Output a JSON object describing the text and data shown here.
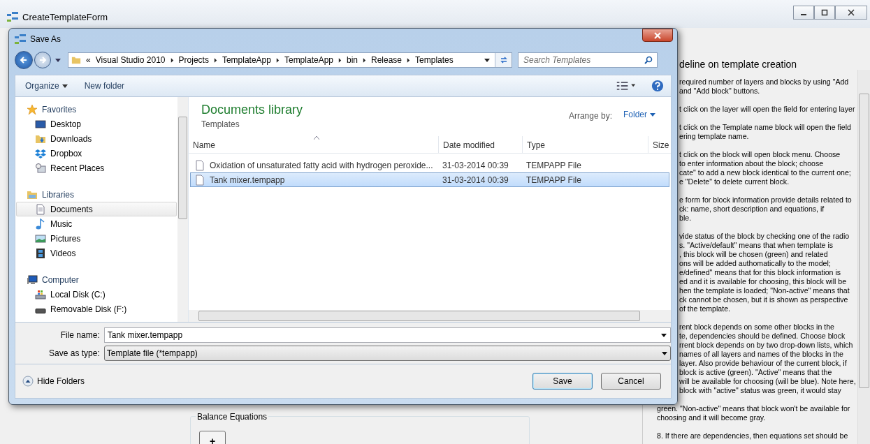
{
  "window": {
    "title": "CreateTemplateForm"
  },
  "guideline": {
    "heading": "deline on template creation",
    "upper_paragraphs": [
      [
        "required number of layers and blocks by using \"Add",
        "and \"Add block\" buttons."
      ],
      [
        "t click on the layer will open the field for entering layer"
      ],
      [
        "t click on the Template name block will open the field",
        "ering template name."
      ],
      [
        "t click on the block will open block menu. Choose",
        "to enter information about the block; choose",
        "cate\" to add a new block identical to the current one;",
        "e \"Delete\" to delete current block."
      ],
      [
        "e form for block information provide details related to",
        "ck: name, short description and equations, if",
        "ble."
      ],
      [
        "vide status of the block by checking one of the radio",
        "s. \"Active/default\" means that when template is",
        ", this block will be chosen (green) and related",
        "ons will be added authomatically to the model;",
        "e/defined\" means that for this block information is",
        "ed and it is available for choosing, this block will be",
        "hen the template is loaded; \"Non-active\" means that",
        "ck cannot be chosen, but it is shown as perspective",
        "of the template."
      ],
      [
        "rent block depends on some other blocks in the",
        "te, dependencies should be defined. Choose block",
        "rrent block depends on by two drop-down lists, which",
        "names of all layers and names of the blocks in the",
        "layer. Also provide behaviour of the current block, if",
        "block is active (green). \"Active\" means that the",
        "will be available for choosing (will be blue). Note here,",
        "block with \"active\" status was green, it would stay"
      ]
    ],
    "lower_paragraphs": [
      [
        "green. \"Non-active\" means that block won't be available for",
        "choosing and it will become gray."
      ],
      [
        "8. If there are dependencies, then equations set should be"
      ]
    ]
  },
  "balance_group": {
    "title": "Balance Equations",
    "button": "+"
  },
  "dialog": {
    "title": "Save As",
    "breadcrumb": {
      "prefix": "«",
      "parts": [
        "Visual Studio 2010",
        "Projects",
        "TemplateApp",
        "TemplateApp",
        "bin",
        "Release",
        "Templates"
      ]
    },
    "search": {
      "placeholder": "Search Templates"
    },
    "toolbar": {
      "organize": "Organize",
      "new_folder": "New folder"
    },
    "nav": [
      {
        "label": "Favorites",
        "kind": "star",
        "children": [
          {
            "label": "Desktop",
            "kind": "desktop",
            "selected": false
          },
          {
            "label": "Downloads",
            "kind": "downloads",
            "selected": false
          },
          {
            "label": "Dropbox",
            "kind": "dropbox",
            "selected": false
          },
          {
            "label": "Recent Places",
            "kind": "recent",
            "selected": false
          }
        ]
      },
      {
        "label": "Libraries",
        "kind": "library",
        "children": [
          {
            "label": "Documents",
            "kind": "documents",
            "selected": true
          },
          {
            "label": "Music",
            "kind": "music",
            "selected": false
          },
          {
            "label": "Pictures",
            "kind": "pictures",
            "selected": false
          },
          {
            "label": "Videos",
            "kind": "videos",
            "selected": false
          }
        ]
      },
      {
        "label": "Computer",
        "kind": "computer",
        "children": [
          {
            "label": "Local Disk (C:)",
            "kind": "disk",
            "selected": false
          },
          {
            "label": "Removable Disk (F:)",
            "kind": "removable",
            "selected": false
          }
        ]
      }
    ],
    "library": {
      "title": "Documents library",
      "subtitle": "Templates",
      "arrange_label": "Arrange by:",
      "arrange_value": "Folder"
    },
    "columns": [
      {
        "label": "Name",
        "sorted": true
      },
      {
        "label": "Date modified",
        "sorted": false
      },
      {
        "label": "Type",
        "sorted": false
      },
      {
        "label": "Size",
        "sorted": false
      }
    ],
    "rows": [
      {
        "name": "Oxidation of unsaturated fatty acid with hydrogen peroxide...",
        "date": "31-03-2014 00:39",
        "type": "TEMPAPP File",
        "selected": false
      },
      {
        "name": "Tank mixer.tempapp",
        "date": "31-03-2014 00:39",
        "type": "TEMPAPP File",
        "selected": true
      }
    ],
    "file_name": {
      "label": "File name:",
      "value": "Tank mixer.tempapp"
    },
    "save_type": {
      "label": "Save as type:",
      "value": "Template file (*tempapp)"
    },
    "hide_folders": "Hide Folders",
    "buttons": [
      {
        "label": "Save",
        "default": true
      },
      {
        "label": "Cancel",
        "default": false
      }
    ]
  }
}
